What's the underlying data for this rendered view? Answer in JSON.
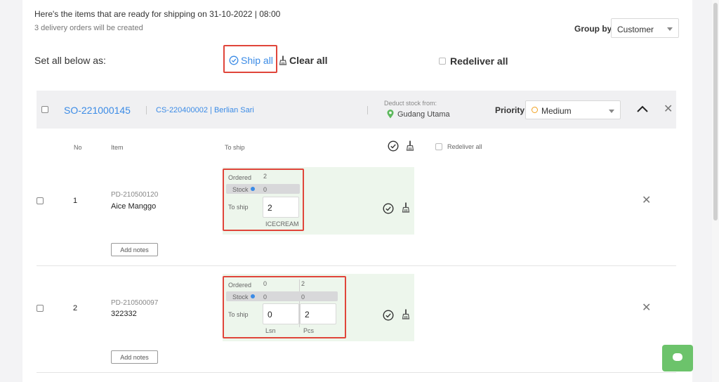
{
  "header": {
    "title": "Here's the items that are ready for shipping on 31-10-2022 | 08:00",
    "subtitle": "3 delivery orders will be created",
    "group_by_label": "Group by:",
    "group_by_value": "Customer"
  },
  "bulk": {
    "label": "Set all below as:",
    "ship_all": "Ship all",
    "clear_all": "Clear all",
    "redeliver_all": "Redeliver all"
  },
  "order": {
    "so_number": "SO-221000145",
    "customer": "CS-220400002 | Berlian Sari",
    "deduct_label": "Deduct stock from:",
    "warehouse": "Gudang Utama",
    "priority_label": "Priority:",
    "priority_value": "Medium"
  },
  "columns": {
    "no": "No",
    "item": "Item",
    "to_ship": "To ship",
    "redeliver_all": "Redeliver all"
  },
  "items": [
    {
      "no": "1",
      "code": "PD-210500120",
      "name": "Aice Manggo",
      "ordered_label": "Ordered",
      "stock_label": "Stock",
      "toship_label": "To ship",
      "ordered": [
        "2"
      ],
      "stock": [
        "0"
      ],
      "to_ship": [
        "2"
      ],
      "units": [
        "ICECREAM"
      ],
      "notes_button": "Add notes"
    },
    {
      "no": "2",
      "code": "PD-210500097",
      "name": "322332",
      "ordered_label": "Ordered",
      "stock_label": "Stock",
      "toship_label": "To ship",
      "ordered": [
        "0",
        "2"
      ],
      "stock": [
        "0",
        "0"
      ],
      "to_ship": [
        "0",
        "2"
      ],
      "units": [
        "Lsn",
        "Pcs"
      ],
      "notes_button": "Add notes"
    }
  ],
  "colors": {
    "link_blue": "#3b8be6",
    "highlight_red": "#e0453a",
    "ship_green_bg": "#edf6ec",
    "chat_green": "#6cc36b",
    "priority_orange": "#f0a020",
    "location_green": "#5cb85c"
  },
  "icons": [
    "check-circle-icon",
    "broom-icon",
    "location-pin-icon",
    "chevron-up-icon",
    "close-icon",
    "chat-icon",
    "status-dot-icon"
  ]
}
